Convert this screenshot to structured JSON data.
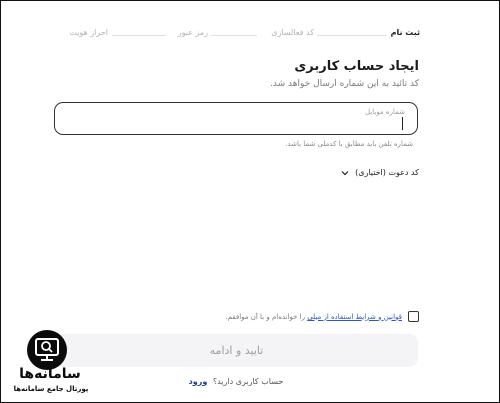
{
  "stepper": {
    "steps": [
      "ثبت نام",
      "کد فعالسازی",
      "رمز عبور",
      "احراز هویت"
    ]
  },
  "header": {
    "title": "ایجاد حساب کاربری",
    "subtitle": "کد تائید به این شماره ارسال خواهد شد."
  },
  "mobile": {
    "label": "شماره موبایل",
    "value": "",
    "hint": "شماره تلفن باید مطابق با کدملی شما باشد."
  },
  "invite": {
    "label": "کد دعوت (اختیاری)"
  },
  "terms": {
    "link": "قوانین و شرایط استفاده از میلی",
    "suffix": "را خوانده‌ام و با آن موافقم."
  },
  "submit": {
    "label": "تایید و ادامه"
  },
  "login": {
    "prompt": "حساب کاربری دارید؟",
    "link": "ورود"
  },
  "logo": {
    "name": "سامانه‌ها",
    "tagline": "پورتال جامع سامانه‌ها"
  },
  "colors": {
    "link": "#2b56c9",
    "login": "#1e3c8c",
    "button_bg": "#f4f4f6"
  }
}
